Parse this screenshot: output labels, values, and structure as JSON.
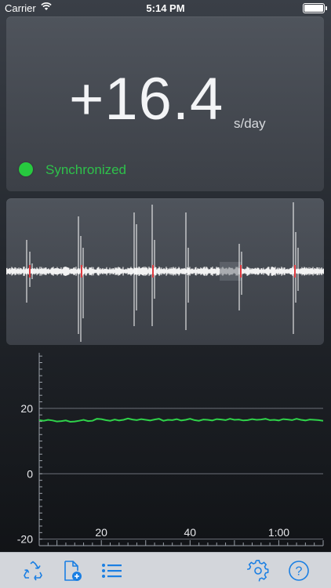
{
  "status_bar": {
    "carrier": "Carrier",
    "time": "5:14 PM"
  },
  "rate": {
    "value": "+16.4",
    "unit": "s/day"
  },
  "sync": {
    "label": "Synchronized",
    "color": "#27c93f"
  },
  "colors": {
    "accent": "#1a7fe3",
    "series": "#2fd24a",
    "tick_marker": "#e0393e"
  },
  "toolbar": {
    "icons": [
      "recycle-icon",
      "new-document-icon",
      "list-icon",
      "gear-icon",
      "help-icon"
    ]
  },
  "chart_data": {
    "type": "line",
    "title": "",
    "xlabel": "",
    "ylabel": "",
    "x_tick_labels": [
      "20",
      "40",
      "1:00"
    ],
    "x_ticks": [
      20,
      40,
      60
    ],
    "y_tick_labels": [
      "20",
      "0",
      "-20"
    ],
    "y_ticks": [
      20,
      0,
      -20
    ],
    "xlim": [
      6,
      70
    ],
    "ylim": [
      -22,
      37
    ],
    "grid": true,
    "series": [
      {
        "color": "#2fd24a",
        "x": [
          6,
          7,
          8,
          9,
          10,
          11,
          12,
          13,
          14,
          15,
          16,
          17,
          18,
          19,
          20,
          21,
          22,
          23,
          24,
          25,
          26,
          27,
          28,
          29,
          30,
          31,
          32,
          33,
          34,
          35,
          36,
          37,
          38,
          39,
          40,
          41,
          42,
          43,
          44,
          45,
          46,
          47,
          48,
          49,
          50,
          51,
          52,
          53,
          54,
          55,
          56,
          57,
          58,
          59,
          60,
          61,
          62,
          63,
          64,
          65,
          66,
          67,
          68,
          69,
          70
        ],
        "y": [
          16.4,
          16.2,
          16.5,
          16.3,
          16.0,
          16.1,
          16.3,
          15.9,
          16.0,
          16.2,
          16.5,
          16.1,
          16.2,
          16.8,
          16.7,
          16.4,
          16.2,
          16.6,
          16.3,
          16.5,
          16.9,
          16.6,
          16.4,
          16.7,
          16.5,
          16.3,
          16.6,
          16.8,
          16.2,
          16.5,
          16.4,
          16.7,
          16.3,
          16.5,
          16.8,
          16.4,
          16.2,
          16.6,
          16.5,
          16.3,
          16.7,
          16.6,
          16.4,
          16.8,
          16.5,
          16.6,
          16.3,
          16.4,
          16.7,
          16.5,
          16.6,
          16.8,
          16.4,
          16.5,
          16.3,
          16.7,
          16.6,
          16.4,
          16.8,
          16.5,
          16.3,
          16.6,
          16.5,
          16.4,
          16.2
        ]
      }
    ]
  }
}
